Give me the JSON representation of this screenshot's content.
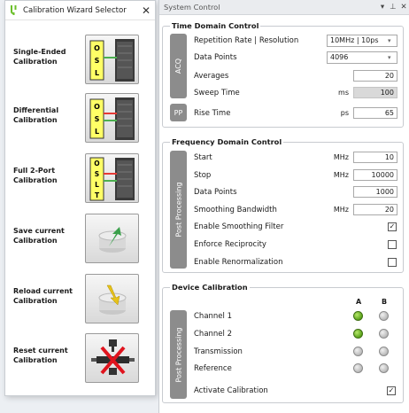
{
  "wizard": {
    "title": "Calibration Wizard Selector",
    "close_label": "✕",
    "items": [
      {
        "label": "Single-Ended\nCalibration",
        "icon": "osl-single-icon"
      },
      {
        "label": "Differential\nCalibration",
        "icon": "osl-differential-icon"
      },
      {
        "label": "Full 2-Port\nCalibration",
        "icon": "oslt-2port-icon"
      },
      {
        "label": "Save current\nCalibration",
        "icon": "save-calibration-icon"
      },
      {
        "label": "Reload current\nCalibration",
        "icon": "reload-calibration-icon"
      },
      {
        "label": "Reset current\nCalibration",
        "icon": "reset-calibration-icon"
      }
    ],
    "osl_letters": [
      "O",
      "S",
      "L"
    ],
    "oslt_letters": [
      "O",
      "S",
      "L",
      "T"
    ]
  },
  "system": {
    "title": "System Control",
    "header_icons": {
      "dropdown": "▾",
      "pin": "⊥",
      "close": "✕"
    },
    "time_domain": {
      "title": "Time Domain Control",
      "tab_acq": "ACQ",
      "tab_pp": "PP",
      "repetition_label": "Repetition Rate | Resolution",
      "repetition_value": "10MHz | 10ps",
      "datapoints_label": "Data Points",
      "datapoints_value": "4096",
      "averages_label": "Averages",
      "averages_value": "20",
      "sweep_label": "Sweep Time",
      "sweep_unit": "ms",
      "sweep_value": "100",
      "rise_label": "Rise Time",
      "rise_unit": "ps",
      "rise_value": "65"
    },
    "frequency_domain": {
      "title": "Frequency Domain Control",
      "tab": "Post Processing",
      "start_label": "Start",
      "start_unit": "MHz",
      "start_value": "10",
      "stop_label": "Stop",
      "stop_unit": "MHz",
      "stop_value": "10000",
      "dp_label": "Data Points",
      "dp_value": "1000",
      "bw_label": "Smoothing Bandwidth",
      "bw_unit": "MHz",
      "bw_value": "20",
      "smooth_label": "Enable Smoothing Filter",
      "smooth_checked": "✓",
      "recip_label": "Enforce Reciprocity",
      "renorm_label": "Enable Renormalization"
    },
    "device_calibration": {
      "title": "Device Calibration",
      "tab": "Post Processing",
      "col_a": "A",
      "col_b": "B",
      "channels": [
        {
          "label": "Channel 1",
          "a": "on",
          "b": "off"
        },
        {
          "label": "Channel 2",
          "a": "on",
          "b": "off"
        },
        {
          "label": "Transmission",
          "a": "off",
          "b": "off"
        },
        {
          "label": "Reference",
          "a": "off",
          "b": "off"
        }
      ],
      "activate_label": "Activate Calibration",
      "activate_checked": "✓"
    }
  },
  "colors": {
    "led_on": "#5aa21a",
    "led_off": "#b9b9b9",
    "tab_gray": "#8c8c8c",
    "osl_yellow": "#ffff66"
  }
}
